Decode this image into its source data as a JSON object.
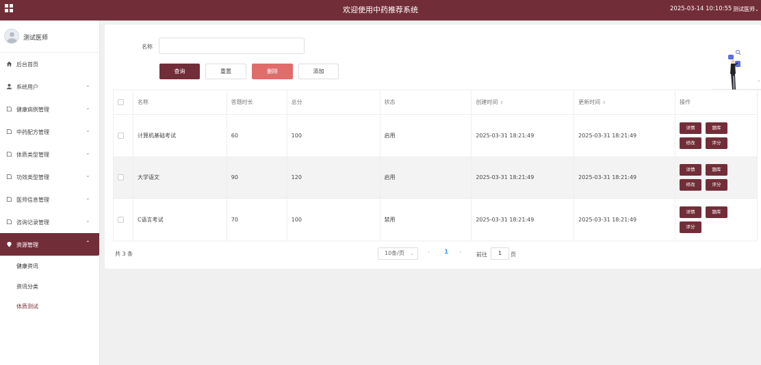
{
  "header": {
    "title": "欢迎使用中药推荐系统",
    "datetime": "2025-03-14 10:10:55",
    "user": "测试医师"
  },
  "sidebar": {
    "user_name": "测试医师",
    "items": [
      {
        "label": "后台首页",
        "icon": "home-icon"
      },
      {
        "label": "系统用户",
        "icon": "user-icon"
      },
      {
        "label": "健康病例管理",
        "icon": "document-icon"
      },
      {
        "label": "中药配方管理",
        "icon": "document-icon"
      },
      {
        "label": "体质类型管理",
        "icon": "document-icon"
      },
      {
        "label": "功效类型管理",
        "icon": "document-icon"
      },
      {
        "label": "医师信息管理",
        "icon": "document-icon"
      },
      {
        "label": "咨询记录管理",
        "icon": "document-icon"
      },
      {
        "label": "资源管理",
        "icon": "location-pin-icon"
      }
    ],
    "submenu": [
      "健康资讯",
      "资讯分类",
      "体质测试"
    ]
  },
  "filter": {
    "name_label": "名称",
    "name_value": ""
  },
  "toolbar": {
    "query": "查询",
    "reset": "重置",
    "delete": "删除",
    "add": "添加"
  },
  "table": {
    "columns": [
      "名称",
      "答题时长",
      "总分",
      "状态",
      "创建时间",
      "更新时间",
      "操作"
    ],
    "rows": [
      {
        "name": "计算机基础考试",
        "duration": "60",
        "score": "100",
        "status": "启用",
        "created": "2025-03-31 18:21:49",
        "updated": "2025-03-31 18:21:49",
        "ops": [
          "详情",
          "题库",
          "修改",
          "评分"
        ]
      },
      {
        "name": "大学语文",
        "duration": "90",
        "score": "120",
        "status": "启用",
        "created": "2025-03-31 18:21:49",
        "updated": "2025-03-31 18:21:49",
        "ops": [
          "详情",
          "题库",
          "修改",
          "评分"
        ]
      },
      {
        "name": "C语言考试",
        "duration": "70",
        "score": "100",
        "status": "禁用",
        "created": "2025-03-31 18:21:49",
        "updated": "2025-03-31 18:21:49",
        "ops": [
          "详情",
          "题库",
          "评分"
        ]
      }
    ]
  },
  "pagination": {
    "total": "共 3 条",
    "page_size": "10条/页",
    "current_page": "1",
    "goto_label": "前往",
    "goto_value": "1",
    "goto_suffix": "页"
  },
  "colors": {
    "primary": "#722e38",
    "danger": "#e06c6c",
    "active_page": "#409eff"
  }
}
